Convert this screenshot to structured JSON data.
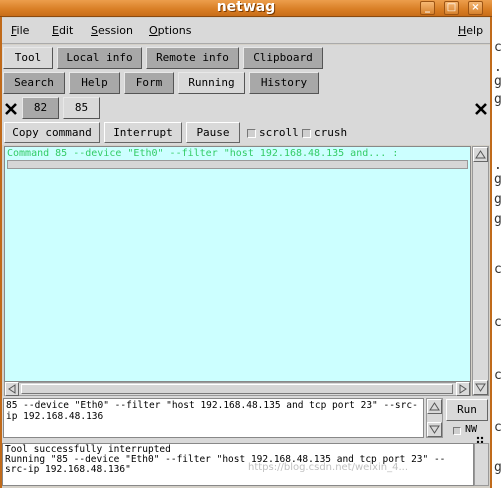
{
  "window": {
    "title": "netwag"
  },
  "menu": [
    {
      "label": "File",
      "u": "F",
      "rest": "ile"
    },
    {
      "label": "Edit",
      "u": "E",
      "rest": "dit"
    },
    {
      "label": "Session",
      "u": "S",
      "rest": "ession"
    },
    {
      "label": "Options",
      "u": "O",
      "rest": "ptions"
    },
    {
      "label": "Help",
      "u": "H",
      "rest": "elp"
    }
  ],
  "tabs_row1": [
    "Tool",
    "Local info",
    "Remote info",
    "Clipboard"
  ],
  "tabs_row2": [
    "Search",
    "Help",
    "Form",
    "Running",
    "History"
  ],
  "active_tab_row2": "Running",
  "sessions": [
    "82",
    "85"
  ],
  "actions": {
    "copy_command": "Copy command",
    "interrupt": "Interrupt",
    "pause": "Pause",
    "scroll": "scroll",
    "crush": "crush"
  },
  "output": {
    "line": "Command 85 --device \"Eth0\" --filter \"host 192.168.48.135 and... :"
  },
  "command": {
    "text": "85 --device \"Eth0\" --filter \"host 192.168.48.135 and tcp port 23\" --src-ip 192.168.48.136"
  },
  "run": {
    "label": "Run",
    "nw_label": "NW"
  },
  "status": {
    "lines": [
      "Tool successfully interrupted",
      "Running \"85 --device \"Eth0\" --filter \"host 192.168.48.135 and tcp port 23\" --",
      "src-ip 192.168.48.136\""
    ]
  },
  "watermark": "https://blog.csdn.net/weixin_4..."
}
